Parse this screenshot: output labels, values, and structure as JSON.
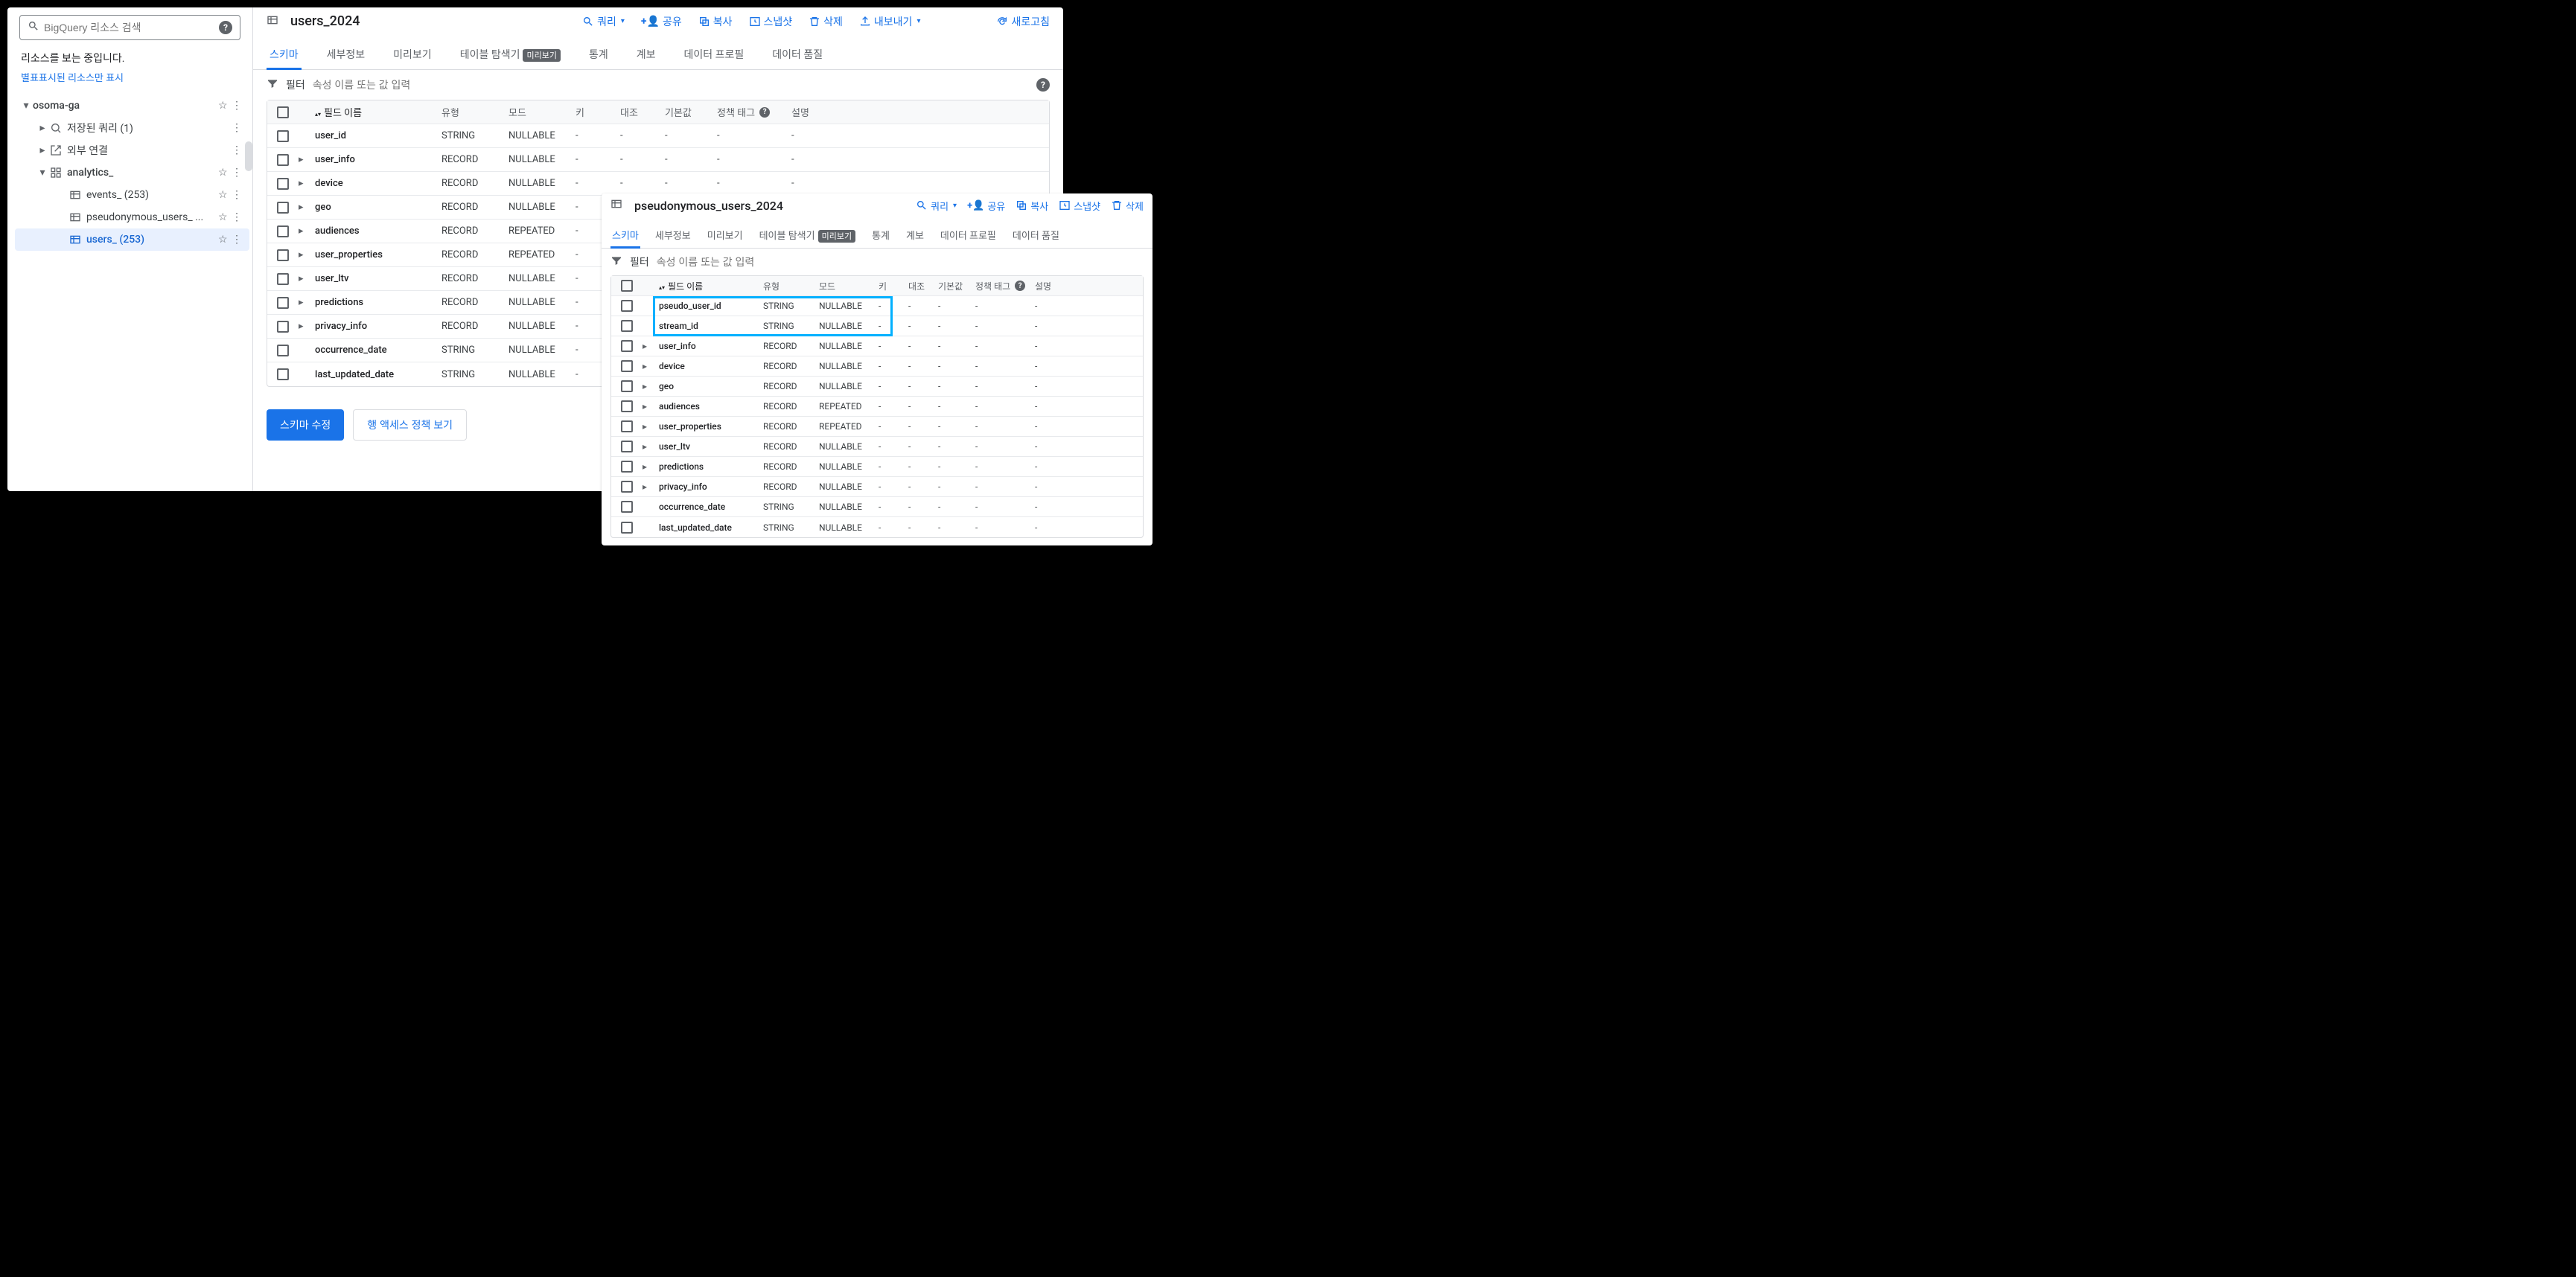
{
  "sidebar": {
    "search_placeholder": "BigQuery 리소스 검색",
    "viewing_msg": "리소스를 보는 중입니다.",
    "starred_link": "별표표시된 리소스만 표시",
    "tree": {
      "project": "osoma-ga",
      "saved_queries": "저장된 쿼리 (1)",
      "external": "외부 연결",
      "dataset": "analytics_",
      "tables": [
        {
          "name": "events_ (253)"
        },
        {
          "name": "pseudonymous_users_ ..."
        },
        {
          "name": "users_ (253)"
        }
      ]
    }
  },
  "main": {
    "title": "users_2024",
    "actions": {
      "query": "쿼리",
      "share": "공유",
      "copy": "복사",
      "snapshot": "스냅샷",
      "delete": "삭제",
      "export": "내보내기",
      "refresh": "새로고침"
    },
    "tabs": {
      "schema": "스키마",
      "details": "세부정보",
      "preview": "미리보기",
      "explorer": "테이블 탐색기",
      "explorer_badge": "미리보기",
      "stats": "통계",
      "lineage": "계보",
      "profile": "데이터 프로필",
      "quality": "데이터 품질"
    },
    "filter": {
      "label": "필터",
      "placeholder": "속성 이름 또는 값 입력"
    },
    "columns": {
      "name": "필드 이름",
      "type": "유형",
      "mode": "모드",
      "key": "키",
      "coll": "대조",
      "def": "기본값",
      "pol": "정책 태그",
      "desc": "설명"
    },
    "schema": [
      {
        "name": "user_id",
        "type": "STRING",
        "mode": "NULLABLE",
        "expandable": false
      },
      {
        "name": "user_info",
        "type": "RECORD",
        "mode": "NULLABLE",
        "expandable": true
      },
      {
        "name": "device",
        "type": "RECORD",
        "mode": "NULLABLE",
        "expandable": true
      },
      {
        "name": "geo",
        "type": "RECORD",
        "mode": "NULLABLE",
        "expandable": true
      },
      {
        "name": "audiences",
        "type": "RECORD",
        "mode": "REPEATED",
        "expandable": true
      },
      {
        "name": "user_properties",
        "type": "RECORD",
        "mode": "REPEATED",
        "expandable": true
      },
      {
        "name": "user_ltv",
        "type": "RECORD",
        "mode": "NULLABLE",
        "expandable": true
      },
      {
        "name": "predictions",
        "type": "RECORD",
        "mode": "NULLABLE",
        "expandable": true
      },
      {
        "name": "privacy_info",
        "type": "RECORD",
        "mode": "NULLABLE",
        "expandable": true
      },
      {
        "name": "occurrence_date",
        "type": "STRING",
        "mode": "NULLABLE",
        "expandable": false
      },
      {
        "name": "last_updated_date",
        "type": "STRING",
        "mode": "NULLABLE",
        "expandable": false
      }
    ],
    "buttons": {
      "edit_schema": "스키마 수정",
      "row_policy": "행 액세스 정책 보기"
    }
  },
  "overlay": {
    "title": "pseudonymous_users_2024",
    "schema": [
      {
        "name": "pseudo_user_id",
        "type": "STRING",
        "mode": "NULLABLE",
        "expandable": false
      },
      {
        "name": "stream_id",
        "type": "STRING",
        "mode": "NULLABLE",
        "expandable": false
      },
      {
        "name": "user_info",
        "type": "RECORD",
        "mode": "NULLABLE",
        "expandable": true
      },
      {
        "name": "device",
        "type": "RECORD",
        "mode": "NULLABLE",
        "expandable": true
      },
      {
        "name": "geo",
        "type": "RECORD",
        "mode": "NULLABLE",
        "expandable": true
      },
      {
        "name": "audiences",
        "type": "RECORD",
        "mode": "REPEATED",
        "expandable": true
      },
      {
        "name": "user_properties",
        "type": "RECORD",
        "mode": "REPEATED",
        "expandable": true
      },
      {
        "name": "user_ltv",
        "type": "RECORD",
        "mode": "NULLABLE",
        "expandable": true
      },
      {
        "name": "predictions",
        "type": "RECORD",
        "mode": "NULLABLE",
        "expandable": true
      },
      {
        "name": "privacy_info",
        "type": "RECORD",
        "mode": "NULLABLE",
        "expandable": true
      },
      {
        "name": "occurrence_date",
        "type": "STRING",
        "mode": "NULLABLE",
        "expandable": false
      },
      {
        "name": "last_updated_date",
        "type": "STRING",
        "mode": "NULLABLE",
        "expandable": false
      }
    ]
  }
}
